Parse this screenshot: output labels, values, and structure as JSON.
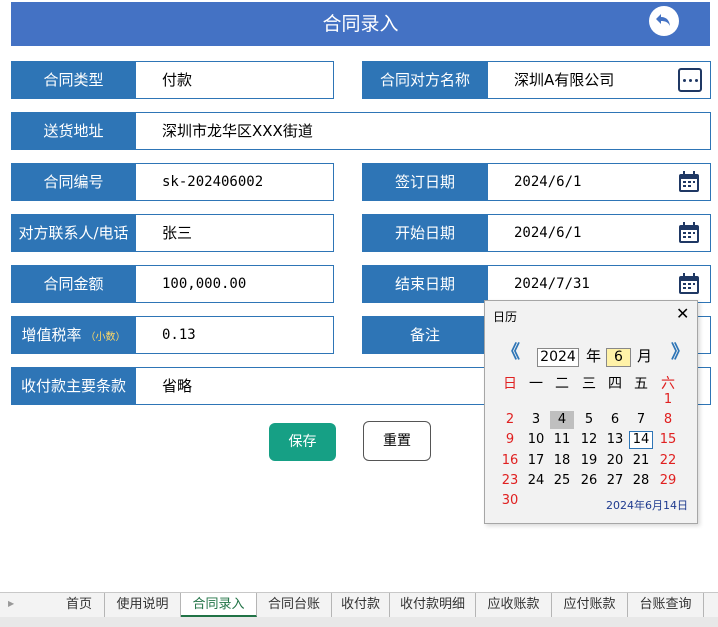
{
  "header": {
    "title": "合同录入"
  },
  "form": {
    "contract_type_label": "合同类型",
    "contract_type_value": "付款",
    "counterparty_label": "合同对方名称",
    "counterparty_value": "深圳A有限公司",
    "address_label": "送货地址",
    "address_value": "深圳市龙华区XXX街道",
    "contract_no_label": "合同编号",
    "contract_no_value": "sk-202406002",
    "sign_date_label": "签订日期",
    "sign_date_value": "2024/6/1",
    "contact_label": "对方联系人/电话",
    "contact_value": "张三",
    "start_date_label": "开始日期",
    "start_date_value": "2024/6/1",
    "amount_label": "合同金额",
    "amount_value": "100,000.00",
    "end_date_label": "结束日期",
    "end_date_value": "2024/7/31",
    "tax_rate_label": "增值税率",
    "tax_rate_note": "（小数）",
    "tax_rate_value": "0.13",
    "remark_label": "备注",
    "remark_value": "",
    "terms_label": "收付款主要条款",
    "terms_value": "省略"
  },
  "buttons": {
    "save": "保存",
    "reset": "重置"
  },
  "calendar": {
    "title": "日历",
    "close": "✕",
    "prev": "《",
    "next": "》",
    "year": "2024",
    "year_label": "年",
    "month": "6",
    "month_label": "月",
    "weekdays": [
      "日",
      "一",
      "二",
      "三",
      "四",
      "五",
      "六"
    ],
    "days": [
      [
        "",
        "",
        "",
        "",
        "",
        "",
        "1"
      ],
      [
        "2",
        "3",
        "4",
        "5",
        "6",
        "7",
        "8"
      ],
      [
        "9",
        "10",
        "11",
        "12",
        "13",
        "14",
        "15"
      ],
      [
        "16",
        "17",
        "18",
        "19",
        "20",
        "21",
        "22"
      ],
      [
        "23",
        "24",
        "25",
        "26",
        "27",
        "28",
        "29"
      ],
      [
        "30",
        "",
        "",
        "",
        "",
        "",
        ""
      ]
    ],
    "selected_day": "4",
    "today_day": "14",
    "footer": "2024年6月14日"
  },
  "sheet_tabs": [
    "首页",
    "使用说明",
    "合同录入",
    "合同台账",
    "收付款",
    "收付款明细",
    "应收账款",
    "应付账款",
    "台账查询"
  ],
  "active_tab": "合同录入",
  "colors": {
    "header": "#4472c4",
    "label_bg": "#2e75b6",
    "save_button": "#16a085",
    "weekend": "#e02020",
    "active_tab": "#217346"
  }
}
